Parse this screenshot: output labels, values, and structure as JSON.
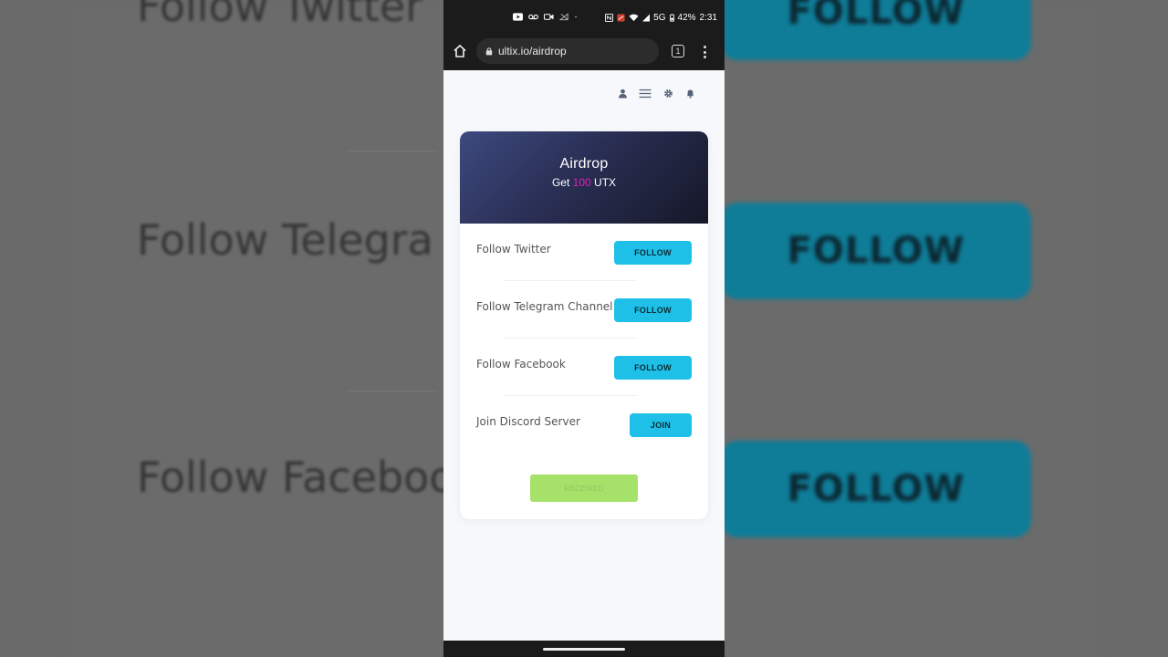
{
  "background": {
    "texts": [
      "Follow Twitter",
      "Follow Telegra",
      "Follow Faceboo"
    ],
    "buttons": [
      "FOLLOW",
      "FOLLOW",
      "FOLLOW"
    ]
  },
  "statusbar": {
    "network": "5G",
    "battery": "42%",
    "time": "2:31"
  },
  "browser": {
    "url": "ultix.io/airdrop",
    "tab_count": "1"
  },
  "card": {
    "title": "Airdrop",
    "subtitle_prefix": "Get",
    "amount": "100",
    "currency": "UTX",
    "tasks": [
      {
        "label": "Follow Twitter",
        "button": "FOLLOW"
      },
      {
        "label": "Follow Telegram Channel",
        "button": "FOLLOW"
      },
      {
        "label": "Follow Facebook",
        "button": "FOLLOW"
      },
      {
        "label": "Join Discord Server",
        "button": "JOIN"
      }
    ],
    "received_label": "RECEIVED"
  },
  "colors": {
    "accent": "#1fc0e8",
    "amount": "#e020b8",
    "received": "#a6e26a"
  }
}
